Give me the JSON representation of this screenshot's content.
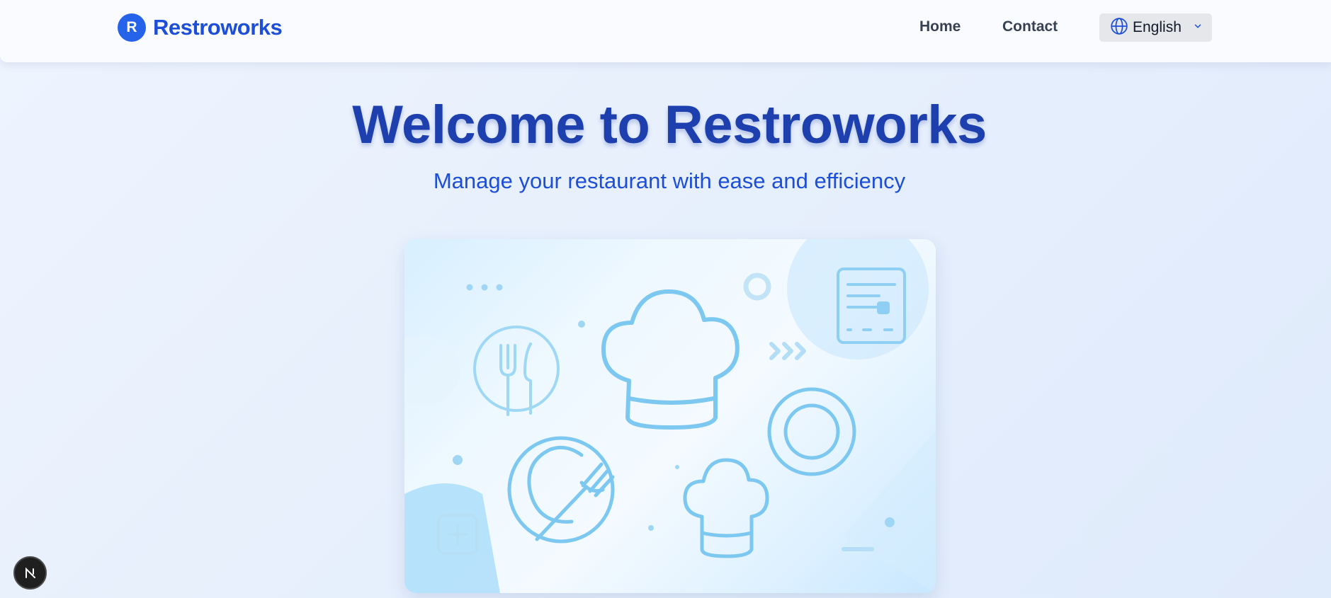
{
  "header": {
    "brand_initial": "R",
    "brand_name": "Restroworks",
    "nav": {
      "home": "Home",
      "contact": "Contact"
    },
    "language": {
      "selected": "English"
    }
  },
  "hero": {
    "title": "Welcome to Restroworks",
    "subtitle": "Manage your restaurant with ease and efficiency"
  },
  "devtools": {
    "initial": "N"
  },
  "colors": {
    "brand": "#2563eb",
    "title": "#1e40af",
    "illustration": "#7cc8f0"
  }
}
